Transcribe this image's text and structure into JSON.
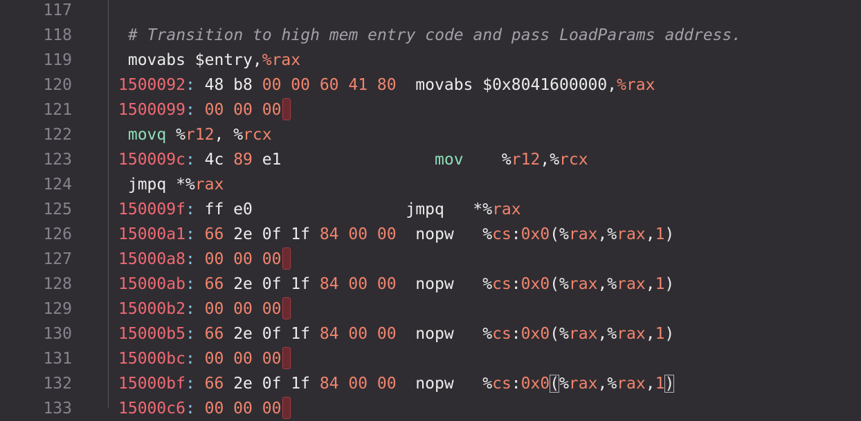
{
  "editor": {
    "lines": [
      {
        "num": "117",
        "tokens": []
      },
      {
        "num": "118",
        "tokens": [
          {
            "t": "# Transition to high mem entry code and pass LoadParams address.",
            "k": "comment"
          }
        ],
        "indent": " "
      },
      {
        "num": "119",
        "tokens": [
          {
            "t": " movabs $entry,",
            "k": "plain"
          },
          {
            "t": "%rax",
            "k": "reg"
          }
        ]
      },
      {
        "num": "120",
        "tokens": [
          {
            "t": "1500092",
            "k": "addr"
          },
          {
            "t": ": ",
            "k": "colon"
          },
          {
            "t": "48 b8 ",
            "k": "plain"
          },
          {
            "t": "00 00 60 41 80",
            "k": "num"
          },
          {
            "t": "  movabs $0x8041600000,",
            "k": "plain"
          },
          {
            "t": "%rax",
            "k": "reg"
          }
        ]
      },
      {
        "num": "121",
        "tokens": [
          {
            "t": "1500099",
            "k": "addr"
          },
          {
            "t": ": ",
            "k": "colon"
          },
          {
            "t": "00 00 00",
            "k": "num"
          }
        ],
        "mark": true
      },
      {
        "num": "122",
        "tokens": [
          {
            "t": " movq ",
            "k": "green"
          },
          {
            "t": "%",
            "k": "plain"
          },
          {
            "t": "r12",
            "k": "reg"
          },
          {
            "t": ", %",
            "k": "plain"
          },
          {
            "t": "rcx",
            "k": "reg"
          }
        ]
      },
      {
        "num": "123",
        "tokens": [
          {
            "t": "150009c",
            "k": "addr"
          },
          {
            "t": ": ",
            "k": "colon"
          },
          {
            "t": "4c ",
            "k": "plain"
          },
          {
            "t": "89",
            "k": "num"
          },
          {
            "t": " e1                ",
            "k": "plain"
          },
          {
            "t": "mov",
            "k": "green"
          },
          {
            "t": "    %",
            "k": "plain"
          },
          {
            "t": "r12",
            "k": "reg"
          },
          {
            "t": ",%",
            "k": "plain"
          },
          {
            "t": "rcx",
            "k": "reg"
          }
        ]
      },
      {
        "num": "124",
        "tokens": [
          {
            "t": " jmpq *%",
            "k": "plain"
          },
          {
            "t": "rax",
            "k": "reg"
          }
        ]
      },
      {
        "num": "125",
        "tokens": [
          {
            "t": "150009f",
            "k": "addr"
          },
          {
            "t": ": ",
            "k": "colon"
          },
          {
            "t": "ff e0                jmpq   *%",
            "k": "plain"
          },
          {
            "t": "rax",
            "k": "reg"
          }
        ]
      },
      {
        "num": "126",
        "tokens": [
          {
            "t": "15000a1",
            "k": "addr"
          },
          {
            "t": ": ",
            "k": "colon"
          },
          {
            "t": "66",
            "k": "num"
          },
          {
            "t": " 2e 0f 1f ",
            "k": "plain"
          },
          {
            "t": "84 00 00",
            "k": "num"
          },
          {
            "t": "  nopw   %",
            "k": "plain"
          },
          {
            "t": "cs",
            "k": "reg"
          },
          {
            "t": ":",
            "k": "plain"
          },
          {
            "t": "0x0",
            "k": "num"
          },
          {
            "t": "(%",
            "k": "plain"
          },
          {
            "t": "rax",
            "k": "reg"
          },
          {
            "t": ",%",
            "k": "plain"
          },
          {
            "t": "rax",
            "k": "reg"
          },
          {
            "t": ",",
            "k": "plain"
          },
          {
            "t": "1",
            "k": "num"
          },
          {
            "t": ")",
            "k": "plain"
          }
        ]
      },
      {
        "num": "127",
        "tokens": [
          {
            "t": "15000a8",
            "k": "addr"
          },
          {
            "t": ": ",
            "k": "colon"
          },
          {
            "t": "00 00 00",
            "k": "num"
          }
        ],
        "mark": true
      },
      {
        "num": "128",
        "tokens": [
          {
            "t": "15000ab",
            "k": "addr"
          },
          {
            "t": ": ",
            "k": "colon"
          },
          {
            "t": "66",
            "k": "num"
          },
          {
            "t": " 2e 0f 1f ",
            "k": "plain"
          },
          {
            "t": "84 00 00",
            "k": "num"
          },
          {
            "t": "  nopw   %",
            "k": "plain"
          },
          {
            "t": "cs",
            "k": "reg"
          },
          {
            "t": ":",
            "k": "plain"
          },
          {
            "t": "0x0",
            "k": "num"
          },
          {
            "t": "(%",
            "k": "plain"
          },
          {
            "t": "rax",
            "k": "reg"
          },
          {
            "t": ",%",
            "k": "plain"
          },
          {
            "t": "rax",
            "k": "reg"
          },
          {
            "t": ",",
            "k": "plain"
          },
          {
            "t": "1",
            "k": "num"
          },
          {
            "t": ")",
            "k": "plain"
          }
        ]
      },
      {
        "num": "129",
        "tokens": [
          {
            "t": "15000b2",
            "k": "addr"
          },
          {
            "t": ": ",
            "k": "colon"
          },
          {
            "t": "00 00 00",
            "k": "num"
          }
        ],
        "mark": true
      },
      {
        "num": "130",
        "tokens": [
          {
            "t": "15000b5",
            "k": "addr"
          },
          {
            "t": ": ",
            "k": "colon"
          },
          {
            "t": "66",
            "k": "num"
          },
          {
            "t": " 2e 0f 1f ",
            "k": "plain"
          },
          {
            "t": "84 00 00",
            "k": "num"
          },
          {
            "t": "  nopw   %",
            "k": "plain"
          },
          {
            "t": "cs",
            "k": "reg"
          },
          {
            "t": ":",
            "k": "plain"
          },
          {
            "t": "0x0",
            "k": "num"
          },
          {
            "t": "(%",
            "k": "plain"
          },
          {
            "t": "rax",
            "k": "reg"
          },
          {
            "t": ",%",
            "k": "plain"
          },
          {
            "t": "rax",
            "k": "reg"
          },
          {
            "t": ",",
            "k": "plain"
          },
          {
            "t": "1",
            "k": "num"
          },
          {
            "t": ")",
            "k": "plain"
          }
        ]
      },
      {
        "num": "131",
        "tokens": [
          {
            "t": "15000bc",
            "k": "addr"
          },
          {
            "t": ": ",
            "k": "colon"
          },
          {
            "t": "00 00 00",
            "k": "num"
          }
        ],
        "mark": true
      },
      {
        "num": "132",
        "tokens": [
          {
            "t": "15000bf",
            "k": "addr"
          },
          {
            "t": ": ",
            "k": "colon"
          },
          {
            "t": "66",
            "k": "num"
          },
          {
            "t": " 2e 0f 1f ",
            "k": "plain"
          },
          {
            "t": "84 00 00",
            "k": "num"
          },
          {
            "t": "  nopw   %",
            "k": "plain"
          },
          {
            "t": "cs",
            "k": "reg"
          },
          {
            "t": ":",
            "k": "plain"
          },
          {
            "t": "0x0",
            "k": "num"
          },
          {
            "t": "(",
            "k": "plain",
            "box": true
          },
          {
            "t": "%",
            "k": "plain"
          },
          {
            "t": "rax",
            "k": "reg"
          },
          {
            "t": ",%",
            "k": "plain"
          },
          {
            "t": "rax",
            "k": "reg"
          },
          {
            "t": ",",
            "k": "plain"
          },
          {
            "t": "1",
            "k": "num"
          },
          {
            "t": ")",
            "k": "plain",
            "box": true
          }
        ]
      },
      {
        "num": "133",
        "tokens": [
          {
            "t": "15000c6",
            "k": "addr"
          },
          {
            "t": ": ",
            "k": "colon"
          },
          {
            "t": "00 00 00",
            "k": "num"
          }
        ],
        "mark": true
      }
    ]
  },
  "colors": {
    "background": "#2f2d32",
    "gutter_text": "#87838e",
    "address": "#f06a73",
    "register": "#f2846d",
    "mnemonic_green": "#8fdfb8",
    "comment": "#a3a0a8"
  }
}
